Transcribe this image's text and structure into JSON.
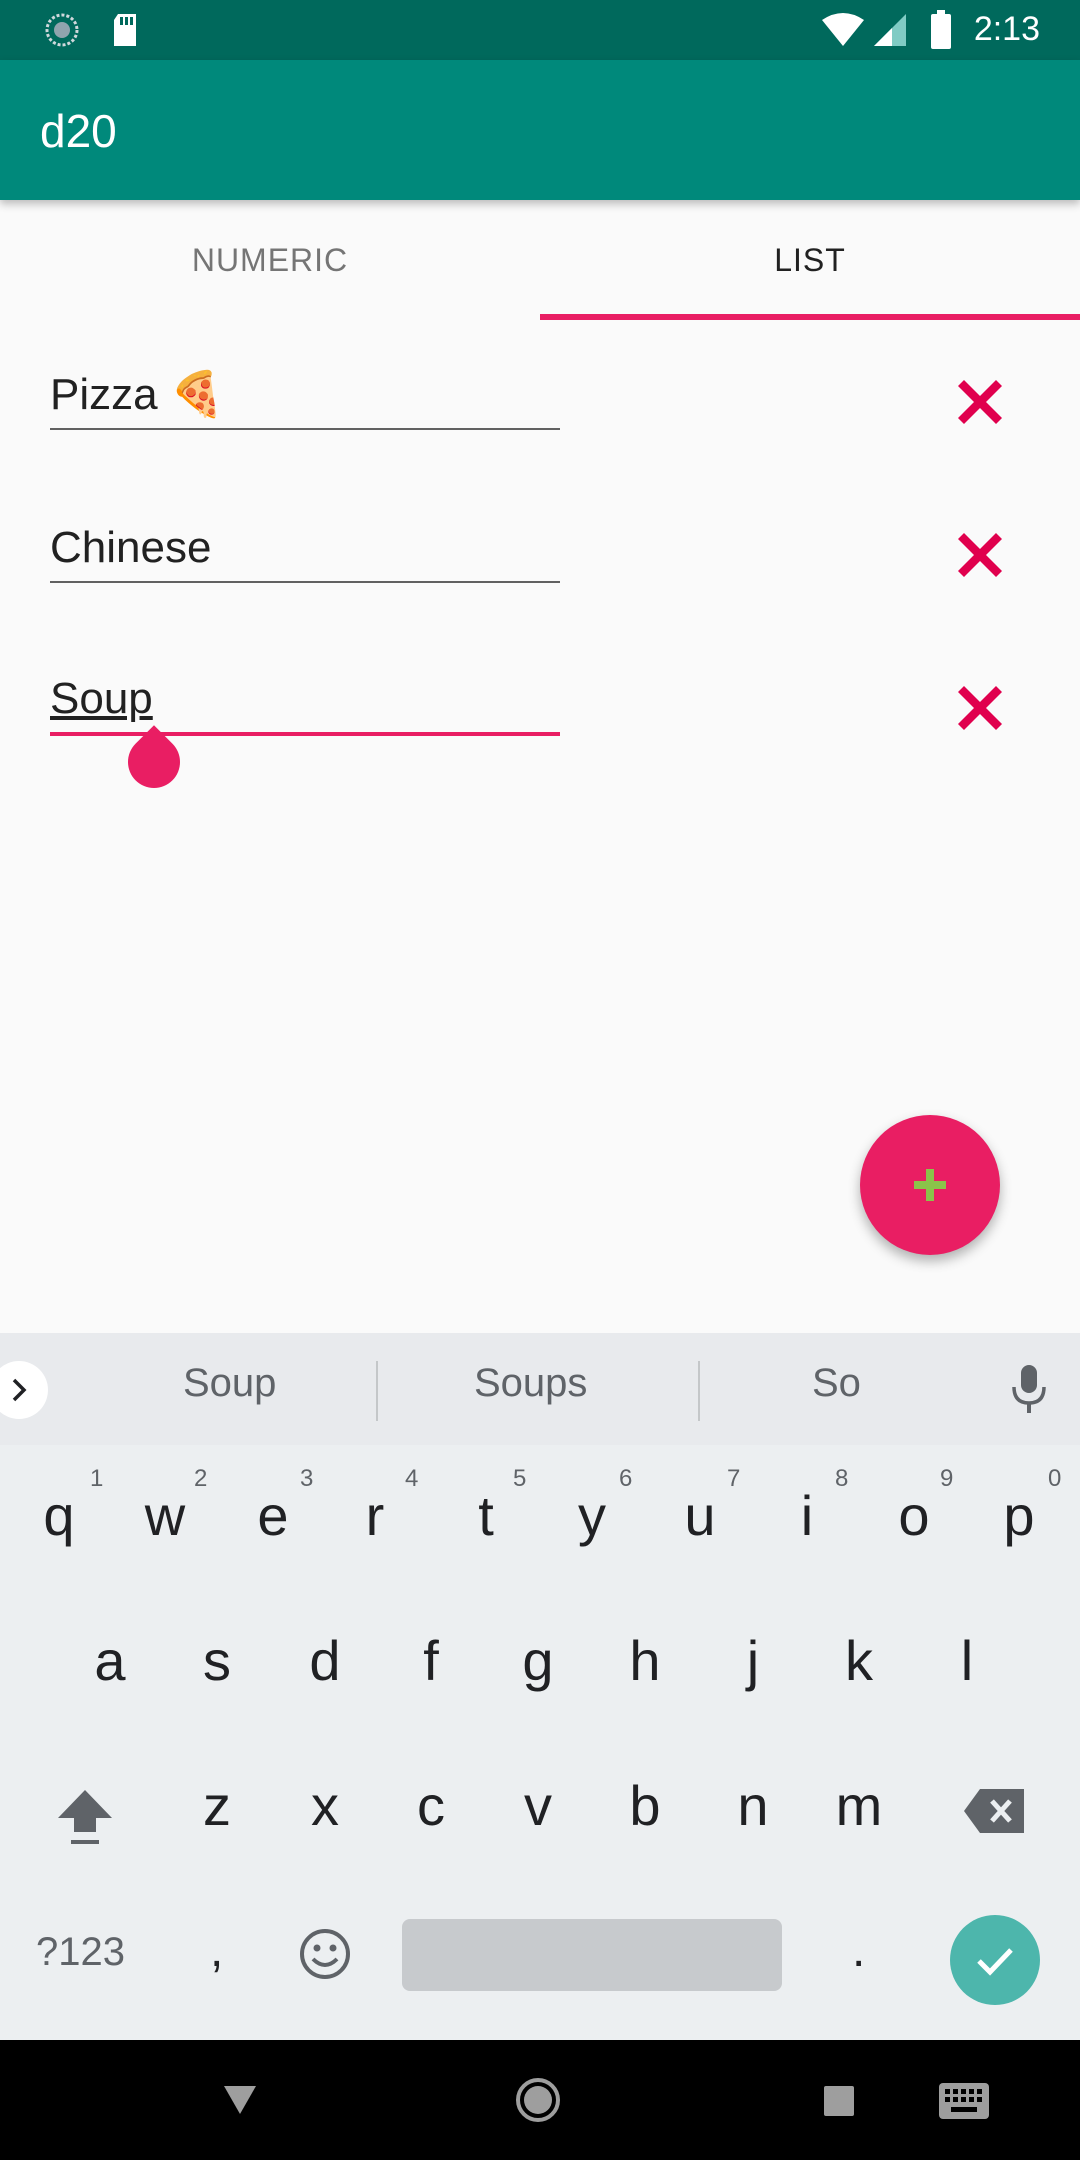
{
  "status_bar": {
    "time": "2:13"
  },
  "app_bar": {
    "title": "d20"
  },
  "tabs": [
    {
      "label": "NUMERIC",
      "active": false
    },
    {
      "label": "LIST",
      "active": true
    }
  ],
  "items": [
    {
      "value": "Pizza 🍕"
    },
    {
      "value": "Chinese"
    },
    {
      "value": "Soup"
    }
  ],
  "colors": {
    "primary": "#00897b",
    "primary_dark": "#00695c",
    "accent": "#e91e63",
    "fab_plus": "#8bc34a"
  },
  "keyboard": {
    "suggestions": [
      "Soup",
      "Soups",
      "So"
    ],
    "row1": [
      "q",
      "w",
      "e",
      "r",
      "t",
      "y",
      "u",
      "i",
      "o",
      "p"
    ],
    "row1_hints": [
      "1",
      "2",
      "3",
      "4",
      "5",
      "6",
      "7",
      "8",
      "9",
      "0"
    ],
    "row2": [
      "a",
      "s",
      "d",
      "f",
      "g",
      "h",
      "j",
      "k",
      "l"
    ],
    "row3": [
      "z",
      "x",
      "c",
      "v",
      "b",
      "n",
      "m"
    ],
    "symbols_label": "?123",
    "comma": ",",
    "period": "."
  }
}
